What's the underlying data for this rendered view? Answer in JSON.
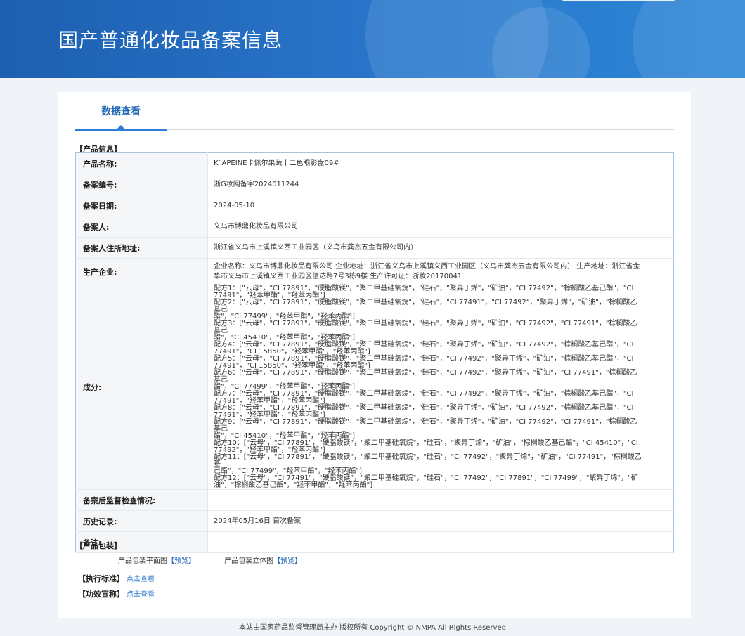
{
  "header": {
    "title": "国产普通化妆品备案信息"
  },
  "tabs": {
    "active": "数据查看"
  },
  "sections": {
    "product_info": "【产品信息】",
    "packaging": "【产品包装】",
    "standard": "【执行标准】",
    "efficacy": "【功效宣称】"
  },
  "product": {
    "name_label": "产品名称:",
    "name": "K`APEINE卡佩尔果蔬十二色眼影盘09#",
    "record_no_label": "备案编号:",
    "record_no": "浙G妆网备字2024011244",
    "record_date_label": "备案日期:",
    "record_date": "2024-05-10",
    "filer_label": "备案人:",
    "filer": "义乌市博鼎化妆品有限公司",
    "filer_address_label": "备案人住所地址:",
    "filer_address": "浙江省义乌市上溪镇义西工业园区（义乌市龚杰五金有限公司内）",
    "manufacturer_label": "生产企业:",
    "manufacturer": "企业名称：义乌市博鼎化妆品有限公司 企业地址：浙江省义乌市上溪镇义西工业园区（义乌市龚杰五金有限公司内） 生产地址：浙江省金华市义乌市上溪镇义西工业园区信达路7号3栋9楼 生产许可证：浙妆20170041",
    "ingredients_label": "成分:",
    "ingredients": [
      "配方1：[\"云母\"，\"CI 77891\"，\"硬脂酸镁\"，\"聚二甲基硅氧烷\"，\"硅石\"，\"聚异丁烯\"，\"矿油\"，\"CI 77492\"，\"棕榈酸乙基己酯\"，\"CI",
      "77491\"，\"羟苯甲酯\"，\"羟苯丙酯\"]",
      "配方2：[\"云母\"，\"CI 77891\"，\"硬脂酸镁\"，\"聚二甲基硅氧烷\"，\"硅石\"，\"CI 77491\"，\"CI 77492\"，\"聚异丁烯\"，\"矿油\"，\"棕榈酸乙基己",
      "酯\"，\"CI 77499\"，\"羟苯甲酯\"，\"羟苯丙酯\"]",
      "配方3：[\"云母\"，\"CI 77891\"，\"硬脂酸镁\"，\"聚二甲基硅氧烷\"，\"硅石\"，\"聚异丁烯\"，\"矿油\"，\"CI 77492\"，\"CI 77491\"，\"棕榈酸乙基己",
      "酯\"，\"CI 45410\"，\"羟苯甲酯\"，\"羟苯丙酯\"]",
      "配方4：[\"云母\"，\"CI 77891\"，\"硬脂酸镁\"，\"聚二甲基硅氧烷\"，\"硅石\"，\"聚异丁烯\"，\"矿油\"，\"CI 77492\"，\"棕榈酸乙基己酯\"，\"CI",
      "77491\"，\"CI 15850\"，\"羟苯甲酯\"，\"羟苯丙酯\"]",
      "配方5：[\"云母\"，\"CI 77891\"，\"硬脂酸镁\"，\"聚二甲基硅氧烷\"，\"硅石\"，\"CI 77492\"，\"聚异丁烯\"，\"矿油\"，\"棕榈酸乙基己酯\"，\"CI",
      "77491\"，\"CI 15850\"，\"羟苯甲酯\"，\"羟苯丙酯\"]",
      "配方6：[\"云母\"，\"CI 77891\"，\"硬脂酸镁\"，\"聚二甲基硅氧烷\"，\"硅石\"，\"CI 77492\"，\"聚异丁烯\"，\"矿油\"，\"CI 77491\"，\"棕榈酸乙基己",
      "酯\"，\"CI 77499\"，\"羟苯甲酯\"，\"羟苯丙酯\"]",
      "配方7：[\"云母\"，\"CI 77891\"，\"硬脂酸镁\"，\"聚二甲基硅氧烷\"，\"硅石\"，\"CI 77492\"，\"聚异丁烯\"，\"矿油\"，\"棕榈酸乙基己酯\"，\"CI",
      "77491\"，\"羟苯甲酯\"，\"羟苯丙酯\"]",
      "配方8：[\"云母\"，\"CI 77891\"，\"硬脂酸镁\"，\"聚二甲基硅氧烷\"，\"硅石\"，\"聚异丁烯\"，\"矿油\"，\"CI 77492\"，\"棕榈酸乙基己酯\"，\"CI",
      "77491\"，\"羟苯甲酯\"，\"羟苯丙酯\"]",
      "配方9：[\"云母\"，\"CI 77891\"，\"硬脂酸镁\"，\"聚二甲基硅氧烷\"，\"硅石\"，\"聚异丁烯\"，\"矿油\"，\"CI 77492\"，\"CI 77491\"，\"棕榈酸乙基己",
      "酯\"，\"CI 45410\"，\"羟苯甲酯\"，\"羟苯丙酯\"]",
      "配方10：[\"云母\"，\"CI 77891\"，\"硬脂酸镁\"，\"聚二甲基硅氧烷\"，\"硅石\"，\"聚异丁烯\"，\"矿油\"，\"棕榈酸乙基己酯\"，\"CI 45410\"，\"CI",
      "77492\"，\"羟苯甲酯\"，\"羟苯丙酯\"]",
      "配方11：[\"云母\"，\"CI 77891\"，\"硬脂酸镁\"，\"聚二甲基硅氧烷\"，\"硅石\"，\"CI 77492\"，\"聚异丁烯\"，\"矿油\"，\"CI 77491\"，\"棕榈酸乙基",
      "己酯\"，\"CI 77499\"，\"羟苯甲酯\"，\"羟苯丙酯\"]",
      "配方12：[\"云母\"，\"CI 77491\"，\"硬脂酸镁\"，\"聚二甲基硅氧烷\"，\"硅石\"，\"CI 77492\"，\"CI 77891\"，\"CI 77499\"，\"聚异丁烯\"，\"矿",
      "油\"，\"棕榈酸乙基己酯\"，\"羟苯甲酯\"，\"羟苯丙酯\"]"
    ],
    "supervision_label": "备案后监督检查情况:",
    "supervision": "",
    "history_label": "历史记录:",
    "history": "2024年05月16日 首次备案",
    "remark_label": "备注:",
    "remark": ""
  },
  "packaging": {
    "flat_label": "产品包装平面图",
    "flat_link": "【预览】",
    "solid_label": "产品包装立体图",
    "solid_link": "【预览】"
  },
  "links": {
    "view": "点击查看"
  },
  "footer": "本站由国家药品监督管理局主办 版权所有 Copyright © NMPA All Rights Reserved"
}
